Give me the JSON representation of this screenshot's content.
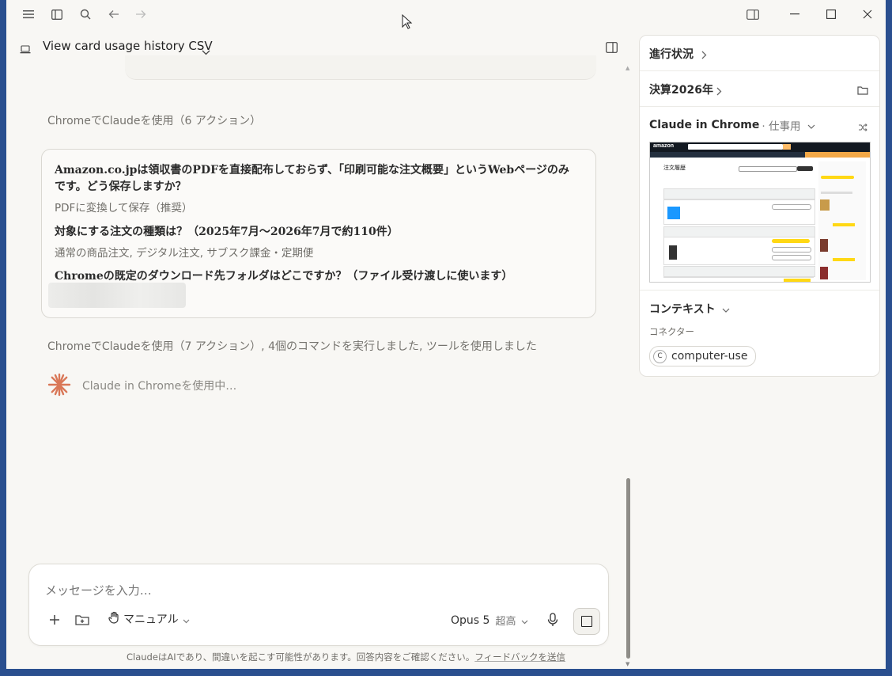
{
  "titlebar": {
    "icons": [
      "menu-icon",
      "sidebar-toggle-icon",
      "search-icon",
      "back-arrow-icon",
      "forward-arrow-icon",
      "panel-icon",
      "minimize-icon",
      "maximize-icon",
      "close-icon"
    ]
  },
  "header": {
    "title": "View card usage history CSV"
  },
  "conversation": {
    "summary1": "ChromeでClaudeを使用（6 アクション）",
    "q1": "Amazon.co.jpは領収書のPDFを直接配布しておらず、「印刷可能な注文概要」というWebページのみです。どう保存しますか？",
    "a1": "PDFに変換して保存（推奨）",
    "q2": "対象にする注文の種類は？（2025年7月〜2026年7月で約110件）",
    "a2": "通常の商品注文, デジタル注文, サブスク課金・定期便",
    "q3": "Chromeの既定のダウンロード先フォルダはどこですか？（ファイル受け渡しに使います）",
    "summary2": "ChromeでClaudeを使用（7 アクション）, 4個のコマンドを実行しました, ツールを使用しました",
    "status": "Claude in Chromeを使用中…"
  },
  "composer": {
    "placeholder": "メッセージを入力…",
    "mode_label": "マニュアル",
    "model": "Opus 5",
    "effort": "超高"
  },
  "footer": {
    "disclaimer": "ClaudeはAIであり、間違いを起こす可能性があります。回答内容をご確認ください。",
    "feedback_link": "フィードバックを送信"
  },
  "right_panel": {
    "progress_title": "進行状況",
    "project_title": "決算2026年",
    "chrome_title": "Claude in Chrome",
    "chrome_profile": "· 仕事用",
    "context_title": "コンテキスト",
    "connectors_label": "コネクター",
    "connector_name": "computer-use",
    "connector_badge": "C",
    "preview": {
      "logo": "amazon",
      "page_heading": "注文履歴"
    }
  },
  "colors": {
    "accent": "#d97757",
    "amazon_dark": "#131921",
    "amazon_yellow": "#ffd814"
  }
}
